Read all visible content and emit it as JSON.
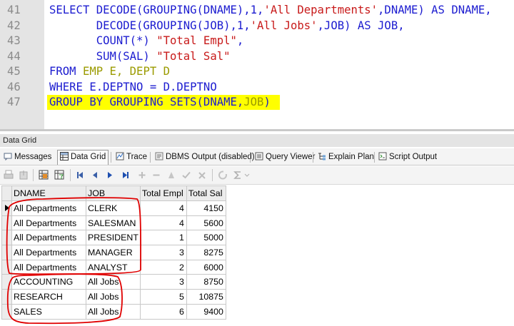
{
  "editor": {
    "lines": [
      {
        "num": "41",
        "tokens": [
          {
            "t": "SELECT DECODE(GROUPING(DNAME),1,",
            "c": "kw"
          },
          {
            "t": "'All Departments'",
            "c": "str"
          },
          {
            "t": ",DNAME) AS DNAME,",
            "c": "kw"
          }
        ]
      },
      {
        "num": "42",
        "tokens": [
          {
            "t": "       DECODE(GROUPING(JOB),1,",
            "c": "kw"
          },
          {
            "t": "'All Jobs'",
            "c": "str"
          },
          {
            "t": ",JOB) AS JOB,",
            "c": "kw"
          }
        ]
      },
      {
        "num": "43",
        "tokens": [
          {
            "t": "       COUNT(*) ",
            "c": "kw"
          },
          {
            "t": "\"Total Empl\"",
            "c": "alias"
          },
          {
            "t": ",",
            "c": "kw"
          }
        ]
      },
      {
        "num": "44",
        "tokens": [
          {
            "t": "       SUM(SAL) ",
            "c": "kw"
          },
          {
            "t": "\"Total Sal\"",
            "c": "alias"
          }
        ]
      },
      {
        "num": "45",
        "tokens": [
          {
            "t": "FROM ",
            "c": "kw"
          },
          {
            "t": "EMP E, DEPT D",
            "c": "hl"
          }
        ]
      },
      {
        "num": "46",
        "tokens": [
          {
            "t": "WHERE E.DEPTNO = D.DEPTNO",
            "c": "kw"
          }
        ]
      },
      {
        "num": "47",
        "tokens": [
          {
            "t": "GROUP BY GROUPING SETS(DNAME,",
            "c": "kw"
          },
          {
            "t": "JOB",
            "c": "hl"
          },
          {
            "t": ")",
            "c": "kw"
          }
        ]
      }
    ],
    "highlight_color": "#ffff00"
  },
  "panel": {
    "title": "Data Grid"
  },
  "tabs": [
    {
      "label": "Messages",
      "icon": "messages-icon"
    },
    {
      "label": "Data Grid",
      "icon": "grid-icon",
      "active": true
    },
    {
      "label": "Trace",
      "icon": "trace-icon"
    },
    {
      "label": "DBMS Output (disabled)",
      "icon": "dbms-output-icon"
    },
    {
      "label": "Query Viewer",
      "icon": "query-viewer-icon"
    },
    {
      "label": "Explain Plan",
      "icon": "explain-plan-icon"
    },
    {
      "label": "Script Output",
      "icon": "script-output-icon"
    }
  ],
  "toolbar": {
    "buttons": [
      "print-icon",
      "export-icon",
      "grid-view-icon",
      "filter-icon",
      "first-record-icon",
      "prior-record-icon",
      "next-record-icon",
      "last-record-icon",
      "insert-record-icon",
      "delete-record-icon",
      "edit-record-icon",
      "post-edit-icon",
      "cancel-edit-icon",
      "refresh-icon",
      "sum-icon"
    ]
  },
  "grid": {
    "columns": [
      "DNAME",
      "JOB",
      "Total Empl",
      "Total Sal"
    ],
    "rows": [
      [
        "All Departments",
        "CLERK",
        "4",
        "4150"
      ],
      [
        "All Departments",
        "SALESMAN",
        "4",
        "5600"
      ],
      [
        "All Departments",
        "PRESIDENT",
        "1",
        "5000"
      ],
      [
        "All Departments",
        "MANAGER",
        "3",
        "8275"
      ],
      [
        "All Departments",
        "ANALYST",
        "2",
        "6000"
      ],
      [
        "ACCOUNTING",
        "All Jobs",
        "3",
        "8750"
      ],
      [
        "RESEARCH",
        "All Jobs",
        "5",
        "10875"
      ],
      [
        "SALES",
        "All Jobs",
        "6",
        "9400"
      ]
    ],
    "current_row": 0
  },
  "colors": {
    "keyword": "#1c1cd0",
    "string": "#c81a1a",
    "identifier_highlight": "#9b9b00",
    "annotation": "#e00000"
  }
}
